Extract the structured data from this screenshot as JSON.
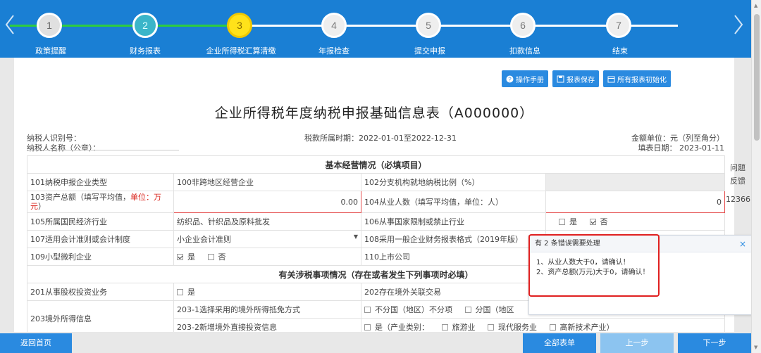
{
  "steps": [
    {
      "number": "1",
      "label": "政策提醒",
      "state": "done"
    },
    {
      "number": "2",
      "label": "财务报表",
      "state": "done"
    },
    {
      "number": "3",
      "label": "企业所得税汇算清缴",
      "state": "active"
    },
    {
      "number": "4",
      "label": "年报检查",
      "state": "todo"
    },
    {
      "number": "5",
      "label": "提交申报",
      "state": "todo"
    },
    {
      "number": "6",
      "label": "扣款信息",
      "state": "todo"
    },
    {
      "number": "7",
      "label": "结束",
      "state": "todo"
    }
  ],
  "toolbar": {
    "manual": "操作手册",
    "save": "报表保存",
    "init_all": "所有报表初始化"
  },
  "title": "企业所得税年度纳税申报基础信息表（A000000）",
  "meta": {
    "taxpayer_id": "纳税人识别号：",
    "taxpayer_name": "纳税人名称（公章）：",
    "period": "税款所属时期：2022-01-01至2022-12-31",
    "unit": "金额单位：元（列至角分）",
    "fill_date": "填表日期：  2023-01-11"
  },
  "section1": "基本经营情况（必填项目）",
  "rows1": {
    "r101_label": "101纳税申报企业类型",
    "r101_value": "100非跨地区经营企业",
    "r102_label": "102分支机构就地纳税比例（%）",
    "r103_label_a": "103资产总额（填写平均值，",
    "r103_label_red": "单位：万元",
    "r103_label_b": "）",
    "r103_value": "0.00",
    "r104_label": "104从业人数（填写平均值，单位：人）",
    "r104_value": "0",
    "r105_label": "105所属国民经济行业",
    "r105_value": "纺织品、针织品及原料批发",
    "r106_label": "106从事国家限制或禁止行业",
    "r106_yes": "是",
    "r106_no": "否",
    "r107_label": "107适用会计准则或会计制度",
    "r107_value": "小企业会计准则",
    "r108_label": "108采用一般企业财务报表格式（2019年版）",
    "r109_label": "109小型微利企业",
    "r109_yes": "是",
    "r109_no": "否",
    "r110_label": "110上市公司"
  },
  "section2": "有关涉税事项情况（存在或者发生下列事项时必填）",
  "rows2": {
    "r201_label": "201从事股权投资业务",
    "r201_yes": "是",
    "r202_label": "202存在境外关联交易",
    "r203_label": "203境外所得信息",
    "r203_1_label": "203-1选择采用的境外所得抵免方式",
    "r203_1_opt1": "不分国（地区）不分项",
    "r203_1_opt2": "分国（地区",
    "r203_2_label": "203-2新增境外直接投资信息",
    "r203_2_opt1": "是（产业类别：",
    "r203_2_opt2": "旅游业",
    "r203_2_opt3": "现代服务业",
    "r203_2_opt4": "高新技术产业）"
  },
  "side": {
    "tab1": "问题",
    "tab2": "反馈",
    "num": "12366"
  },
  "popup": {
    "title": "有 2 条错误需要处理",
    "close": "×",
    "error1": "1、从业人数大于0，请确认！",
    "error2": "2、资产总额(万元)大于0，请确认！"
  },
  "bottom": {
    "home": "返回首页",
    "all_forms": "全部表单",
    "prev": "上一步",
    "next": "下一步"
  },
  "colors": {
    "brand": "#1a7fd4",
    "active_step": "#ffe21a",
    "error": "#e02020"
  }
}
